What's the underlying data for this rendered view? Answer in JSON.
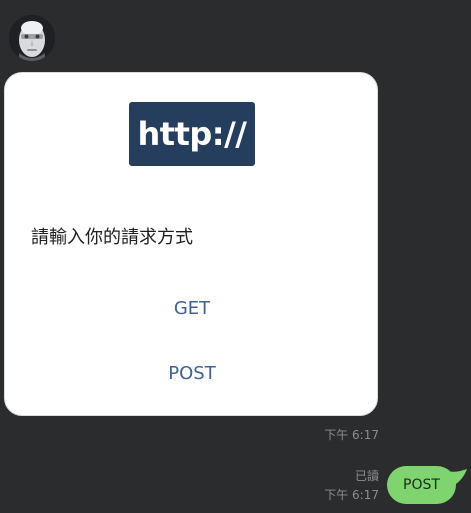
{
  "avatar": {
    "icon": "robot-face-icon"
  },
  "card": {
    "logo_text": "http://",
    "prompt": "請輸入你的請求方式",
    "options": [
      {
        "label": "GET"
      },
      {
        "label": "POST"
      }
    ]
  },
  "card_time": "下午 6:17",
  "sent_message": {
    "read_label": "已讀",
    "time": "下午 6:17",
    "text": "POST",
    "color": "#7fd470"
  },
  "colors": {
    "background": "#2b2c2e",
    "logo_bg": "#263e5d",
    "option_text": "#41618e"
  }
}
